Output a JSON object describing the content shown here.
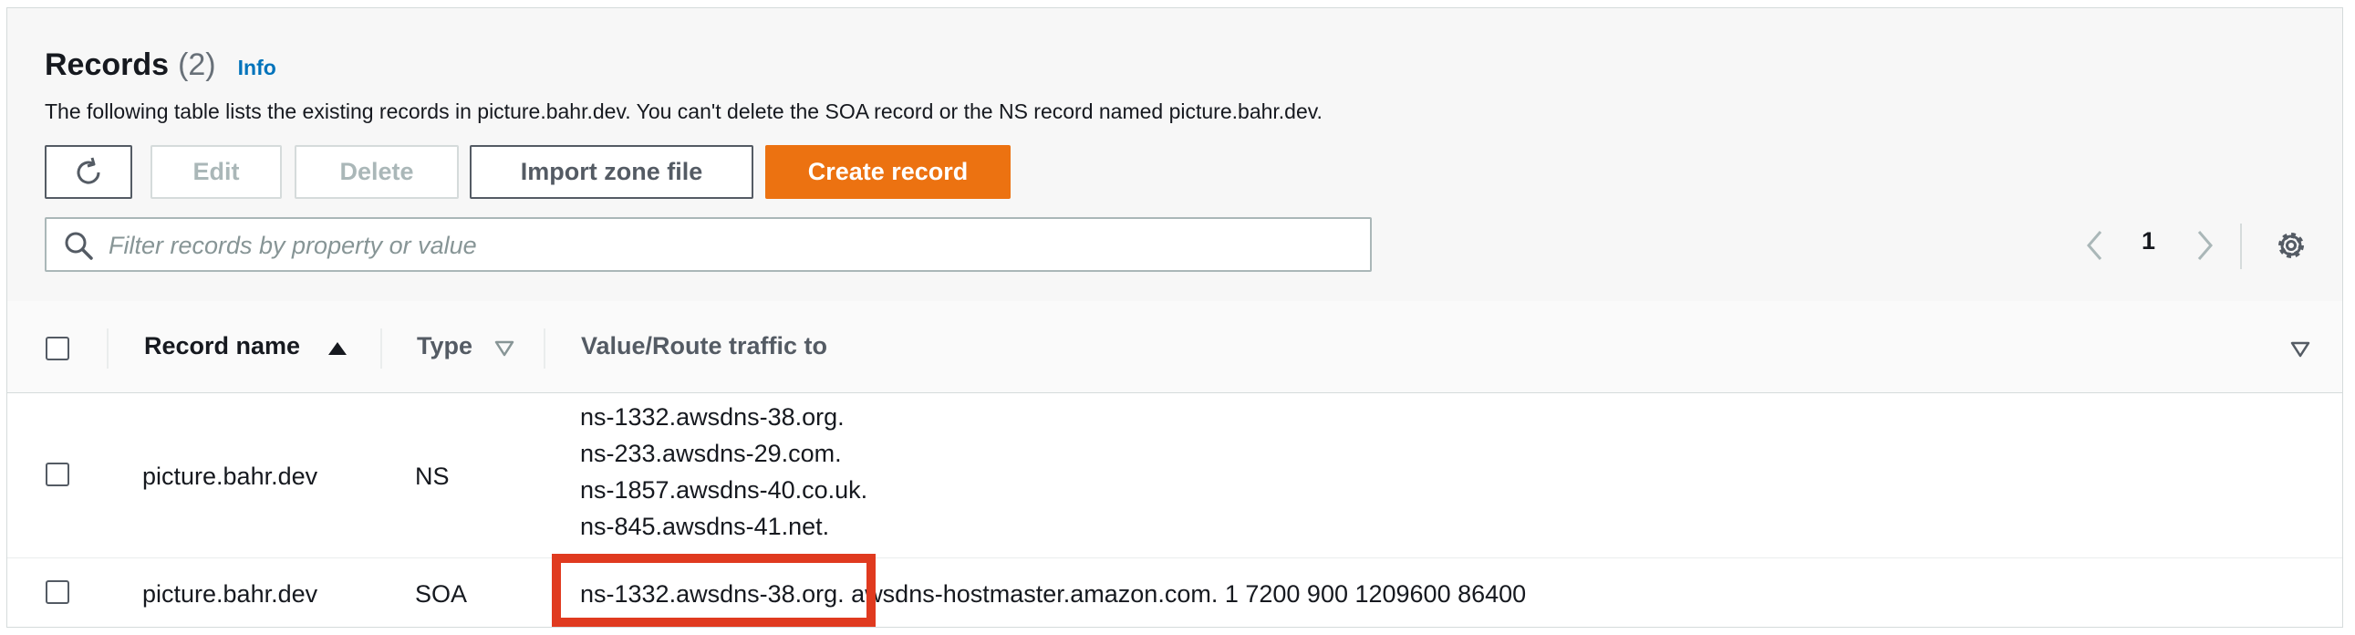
{
  "records": {
    "title": "Records",
    "count": "(2)",
    "info_link": "Info",
    "description": "The following table lists the existing records in picture.bahr.dev. You can't delete the SOA record or the NS record named picture.bahr.dev."
  },
  "toolbar": {
    "refresh_icon": "refresh-icon",
    "edit_label": "Edit",
    "delete_label": "Delete",
    "import_label": "Import zone file",
    "create_label": "Create record"
  },
  "search": {
    "placeholder": "Filter records by property or value",
    "value": ""
  },
  "pagination": {
    "current_page": "1"
  },
  "table": {
    "columns": [
      {
        "label": "Record name",
        "sort": "ascending"
      },
      {
        "label": "Type",
        "sort": "none"
      },
      {
        "label": "Value/Route traffic to",
        "sort": "none"
      }
    ],
    "rows": [
      {
        "name": "picture.bahr.dev",
        "type": "NS",
        "values": [
          "ns-1332.awsdns-38.org.",
          "ns-233.awsdns-29.com.",
          "ns-1857.awsdns-40.co.uk.",
          "ns-845.awsdns-41.net."
        ]
      },
      {
        "name": "picture.bahr.dev",
        "type": "SOA",
        "values": [
          "ns-1332.awsdns-38.org. awsdns-hostmaster.amazon.com. 1 7200 900 1209600 86400"
        ]
      }
    ]
  },
  "colors": {
    "primary_button": "#ec7211",
    "link": "#0073bb",
    "highlight": "#e03a1f"
  }
}
